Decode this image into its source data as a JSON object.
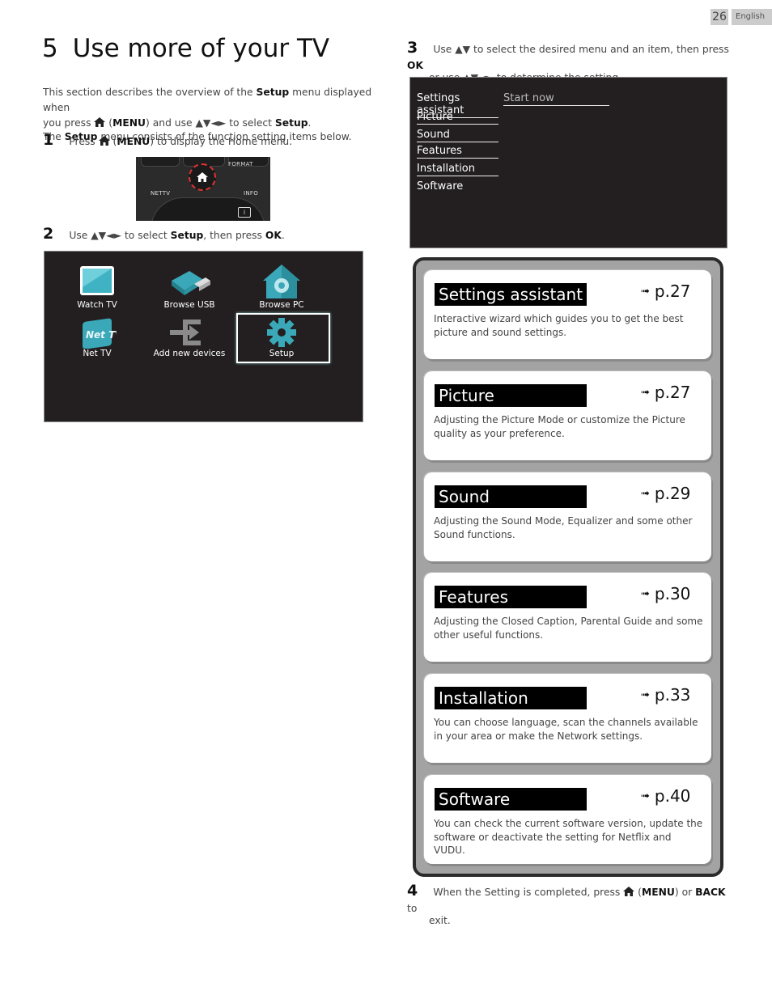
{
  "header": {
    "page_number": "26",
    "language": "English"
  },
  "title": {
    "number": "5",
    "text": "Use more of your TV"
  },
  "intro": {
    "line1_a": "This section describes the overview of the ",
    "line1_b": "Setup",
    "line1_c": " menu displayed when",
    "line2_a": "you press ",
    "line2_b": " (",
    "line2_c": "MENU",
    "line2_d": ") and use ▲▼◄► to select ",
    "line2_e": "Setup",
    "line2_f": ".",
    "line3_a": "The ",
    "line3_b": "Setup",
    "line3_c": " menu consists of the function setting items below."
  },
  "steps": {
    "s1": {
      "num": "1",
      "a": "Press ",
      "b": " (",
      "c": "MENU",
      "d": ") to display the Home menu."
    },
    "s2": {
      "num": "2",
      "a": "Use ▲▼◄► to select ",
      "b": "Setup",
      "c": ", then press ",
      "d": "OK",
      "e": "."
    },
    "s3": {
      "num": "3",
      "a": "Use ▲▼ to select the desired menu and an item, then press ",
      "b": "OK",
      "c": "or use ▲▼◄► to determine the setting."
    },
    "s4": {
      "num": "4",
      "a": "When the Setting is completed, press ",
      "b": " (",
      "c": "MENU",
      "d": ") or ",
      "e": "BACK",
      "f": " to",
      "g": "exit."
    }
  },
  "remote": {
    "format": "FORMAT",
    "nettv": "NETTV",
    "info": "INFO",
    "info_glyph": "i"
  },
  "home_menu": {
    "items": [
      {
        "label": "Watch TV",
        "icon": "tv-icon"
      },
      {
        "label": "Browse USB",
        "icon": "usb-icon"
      },
      {
        "label": "Browse PC",
        "icon": "home-network-icon"
      },
      {
        "label": "Net TV",
        "icon": "nettv-icon",
        "icon_text": "Net TV"
      },
      {
        "label": "Add new devices",
        "icon": "input-icon"
      },
      {
        "label": "Setup",
        "icon": "gear-icon",
        "selected": true
      }
    ]
  },
  "settings_menu": {
    "items": [
      "Settings assistant",
      "Picture",
      "Sound",
      "Features",
      "Installation",
      "Software"
    ],
    "value": "Start now"
  },
  "cards": [
    {
      "title": "Settings assistant",
      "ref": "p.27",
      "desc": "Interactive wizard which guides you to get the best picture and sound settings."
    },
    {
      "title": "Picture",
      "ref": "p.27",
      "desc": "Adjusting the Picture Mode or customize the Picture quality as your preference."
    },
    {
      "title": "Sound",
      "ref": "p.29",
      "desc": "Adjusting the Sound Mode, Equalizer and some other Sound functions."
    },
    {
      "title": "Features",
      "ref": "p.30",
      "desc": "Adjusting the Closed Caption, Parental Guide and some other useful functions."
    },
    {
      "title": "Installation",
      "ref": "p.33",
      "desc": "You can choose language, scan the channels available in your area or make the Network settings."
    },
    {
      "title": "Software",
      "ref": "p.40",
      "desc": "You can check the current software version, update the software or deactivate the setting for Netflix and VUDU."
    }
  ],
  "arrow_glyph": "➟"
}
